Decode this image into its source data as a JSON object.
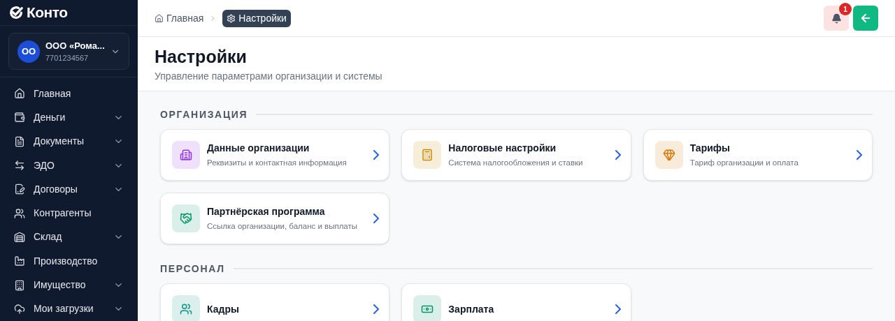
{
  "brand": {
    "name": "Конто"
  },
  "organization": {
    "initials": "ОО",
    "name": "ООО «Рома...",
    "inn": "7701234567"
  },
  "sidebar": {
    "items": [
      {
        "label": "Главная",
        "expandable": false
      },
      {
        "label": "Деньги",
        "expandable": true
      },
      {
        "label": "Документы",
        "expandable": true
      },
      {
        "label": "ЭДО",
        "expandable": true
      },
      {
        "label": "Договоры",
        "expandable": true
      },
      {
        "label": "Контрагенты",
        "expandable": false
      },
      {
        "label": "Склад",
        "expandable": true
      },
      {
        "label": "Производство",
        "expandable": false
      },
      {
        "label": "Имущество",
        "expandable": true
      },
      {
        "label": "Мои загрузки",
        "expandable": true
      }
    ]
  },
  "breadcrumbs": [
    {
      "label": "Главная",
      "selected": false
    },
    {
      "label": "Настройки",
      "selected": true
    }
  ],
  "notifications": {
    "count": "1"
  },
  "page": {
    "title": "Настройки",
    "subtitle": "Управление параметрами организации и системы"
  },
  "sections": [
    {
      "title": "ОРГАНИЗАЦИЯ",
      "cards": [
        {
          "title": "Данные организации",
          "subtitle": "Реквизиты и контактная информация",
          "color": "#9333ea"
        },
        {
          "title": "Налоговые настройки",
          "subtitle": "Система налогообложения и ставки",
          "color": "#ca8a04"
        },
        {
          "title": "Тарифы",
          "subtitle": "Тариф организации и оплата",
          "color": "#d97706"
        },
        {
          "title": "Партнёрская программа",
          "subtitle": "Ссылка организации, баланс и выплаты",
          "color": "#059669"
        }
      ]
    },
    {
      "title": "ПЕРСОНАЛ",
      "cards": [
        {
          "title": "Кадры",
          "color": "#0d9488"
        },
        {
          "title": "Зарплата",
          "color": "#059669"
        }
      ]
    }
  ]
}
